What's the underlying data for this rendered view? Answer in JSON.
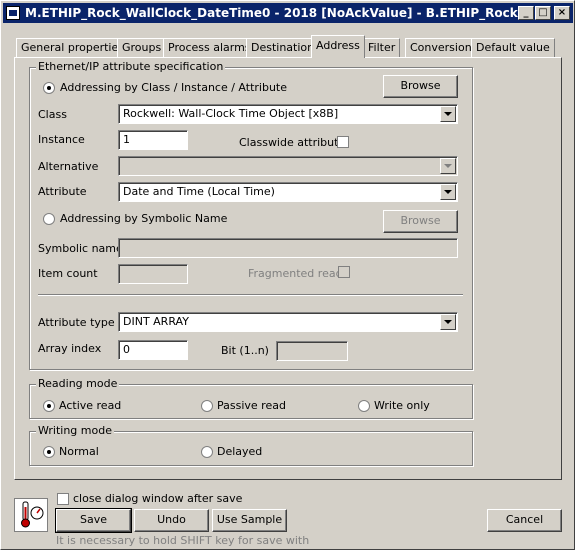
{
  "window": {
    "title": "M.ETHIP_Rock_WallClock_DateTime0 - 2018 [NoAckValue] - B.ETHIP_Rock"
  },
  "tabs": [
    {
      "label": "General properties"
    },
    {
      "label": "Groups"
    },
    {
      "label": "Process alarms"
    },
    {
      "label": "Destination"
    },
    {
      "label": "Address"
    },
    {
      "label": "Filter"
    },
    {
      "label": "Conversion"
    },
    {
      "label": "Default value"
    }
  ],
  "active_tab": "Address",
  "ethip": {
    "group_title": "Ethernet/IP attribute specification",
    "addr_class_label": "Addressing by Class / Instance / Attribute",
    "browse_label": "Browse",
    "class_label": "Class",
    "class_value": "Rockwell: Wall-Clock Time Object [x8B]",
    "instance_label": "Instance",
    "instance_value": "1",
    "classwide_label": "Classwide attribute",
    "alternative_label": "Alternative",
    "alternative_value": "",
    "attribute_label": "Attribute",
    "attribute_value": "Date and Time (Local Time)",
    "addr_symbolic_label": "Addressing by Symbolic Name",
    "browse2_label": "Browse",
    "symbolic_name_label": "Symbolic name",
    "symbolic_name_value": "",
    "item_count_label": "Item count",
    "item_count_value": "",
    "fragmented_label": "Fragmented read",
    "attr_type_label": "Attribute type",
    "attr_type_value": "DINT ARRAY",
    "array_index_label": "Array index",
    "array_index_value": "0",
    "bit_label": "Bit (1..n)",
    "bit_value": ""
  },
  "reading": {
    "title": "Reading mode",
    "active": "Active read",
    "passive": "Passive read",
    "write_only": "Write only"
  },
  "writing": {
    "title": "Writing mode",
    "normal": "Normal",
    "delayed": "Delayed"
  },
  "footer": {
    "close_after_save": "close dialog window after save",
    "save": "Save",
    "undo": "Undo",
    "use_sample": "Use Sample",
    "cancel": "Cancel",
    "hint": "It is necessary to hold SHIFT key for save with"
  },
  "colors": {
    "titlebar": "#0a246a",
    "face": "#d4d0c8"
  }
}
